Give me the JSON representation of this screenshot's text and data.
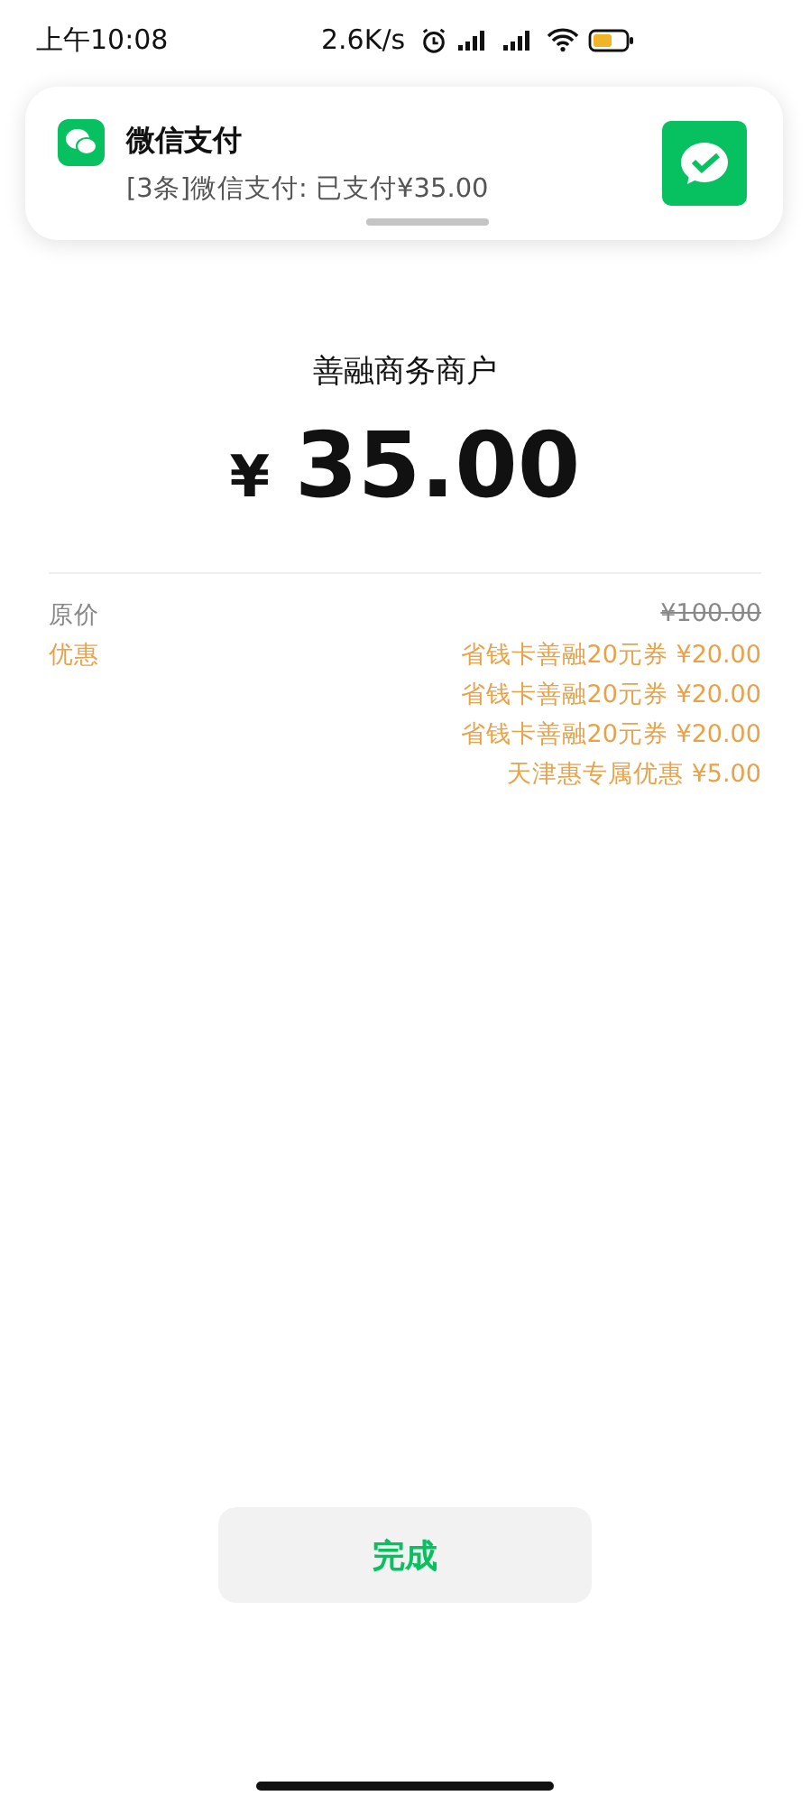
{
  "status_bar": {
    "time": "上午10:08",
    "net_speed": "2.6K/s"
  },
  "notification": {
    "app": "微信支付",
    "message": "[3条]微信支付: 已支付¥35.00"
  },
  "merchant": "善融商务商户",
  "amount": {
    "currency": "¥",
    "value": "35.00"
  },
  "details": [
    {
      "kind": "original",
      "label": "原价",
      "values": [
        "¥100.00"
      ]
    },
    {
      "kind": "discount",
      "label": "优惠",
      "values": [
        "省钱卡善融20元券 ¥20.00",
        "省钱卡善融20元券 ¥20.00",
        "省钱卡善融20元券 ¥20.00",
        "天津惠专属优惠 ¥5.00"
      ]
    }
  ],
  "done_button": "完成"
}
